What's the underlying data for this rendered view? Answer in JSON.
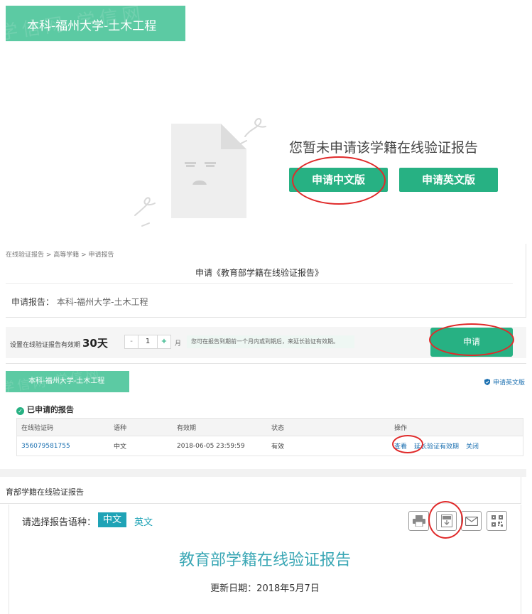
{
  "section_empty": {
    "banner_title": "本科-福州大学-土木工程",
    "banner_watermark": "学信网 学信网",
    "empty_message": "您暂未申请该学籍在线验证报告",
    "apply_chinese_label": "申请中文版",
    "apply_english_label": "申请英文版"
  },
  "section_apply": {
    "breadcrumb": "在线验证报告 > 高等学籍 > 申请报告",
    "title": "申请《教育部学籍在线验证报告》",
    "report_label": "申请报告：",
    "report_value": "本科-福州大学-土木工程",
    "validity_label": "设置在线验证报告有效期",
    "validity_days": "30天",
    "stepper_minus": "-",
    "stepper_value": "1",
    "stepper_plus": "+",
    "month_unit": "月",
    "hint": "您可在报告到期前一个月内或到期后，来延长验证有效期。",
    "apply_button": "申请"
  },
  "section_applied": {
    "tag_title": "本科-福州大学-土木工程",
    "tag_watermark": "学信网 学信网",
    "apply_english_link": "申请英文版",
    "list_title": "已申请的报告",
    "table": {
      "headers": [
        "在线验证码",
        "语种",
        "有效期",
        "状态",
        "操作"
      ],
      "rows": [
        {
          "code": "356079581755",
          "language": "中文",
          "expiry": "2018-06-05 23:59:59",
          "status": "有效",
          "actions": [
            "查看",
            "延长验证有效期",
            "关闭"
          ]
        }
      ]
    }
  },
  "section_report": {
    "panel_title": "育部学籍在线验证报告",
    "language_label": "请选择报告语种：",
    "language_chinese": "中文",
    "language_english": "英文",
    "report_title": "教育部学籍在线验证报告",
    "update_date": "更新日期：2018年5月7日",
    "tools": [
      "printer-icon",
      "pdf-icon",
      "mail-icon",
      "qr-code-icon"
    ]
  },
  "colors": {
    "brand_green": "#27b183",
    "banner_green": "#5ccaa3",
    "teal": "#1fa3b6",
    "link_blue": "#1a6fb0",
    "annotation_red": "#e02a2a"
  }
}
